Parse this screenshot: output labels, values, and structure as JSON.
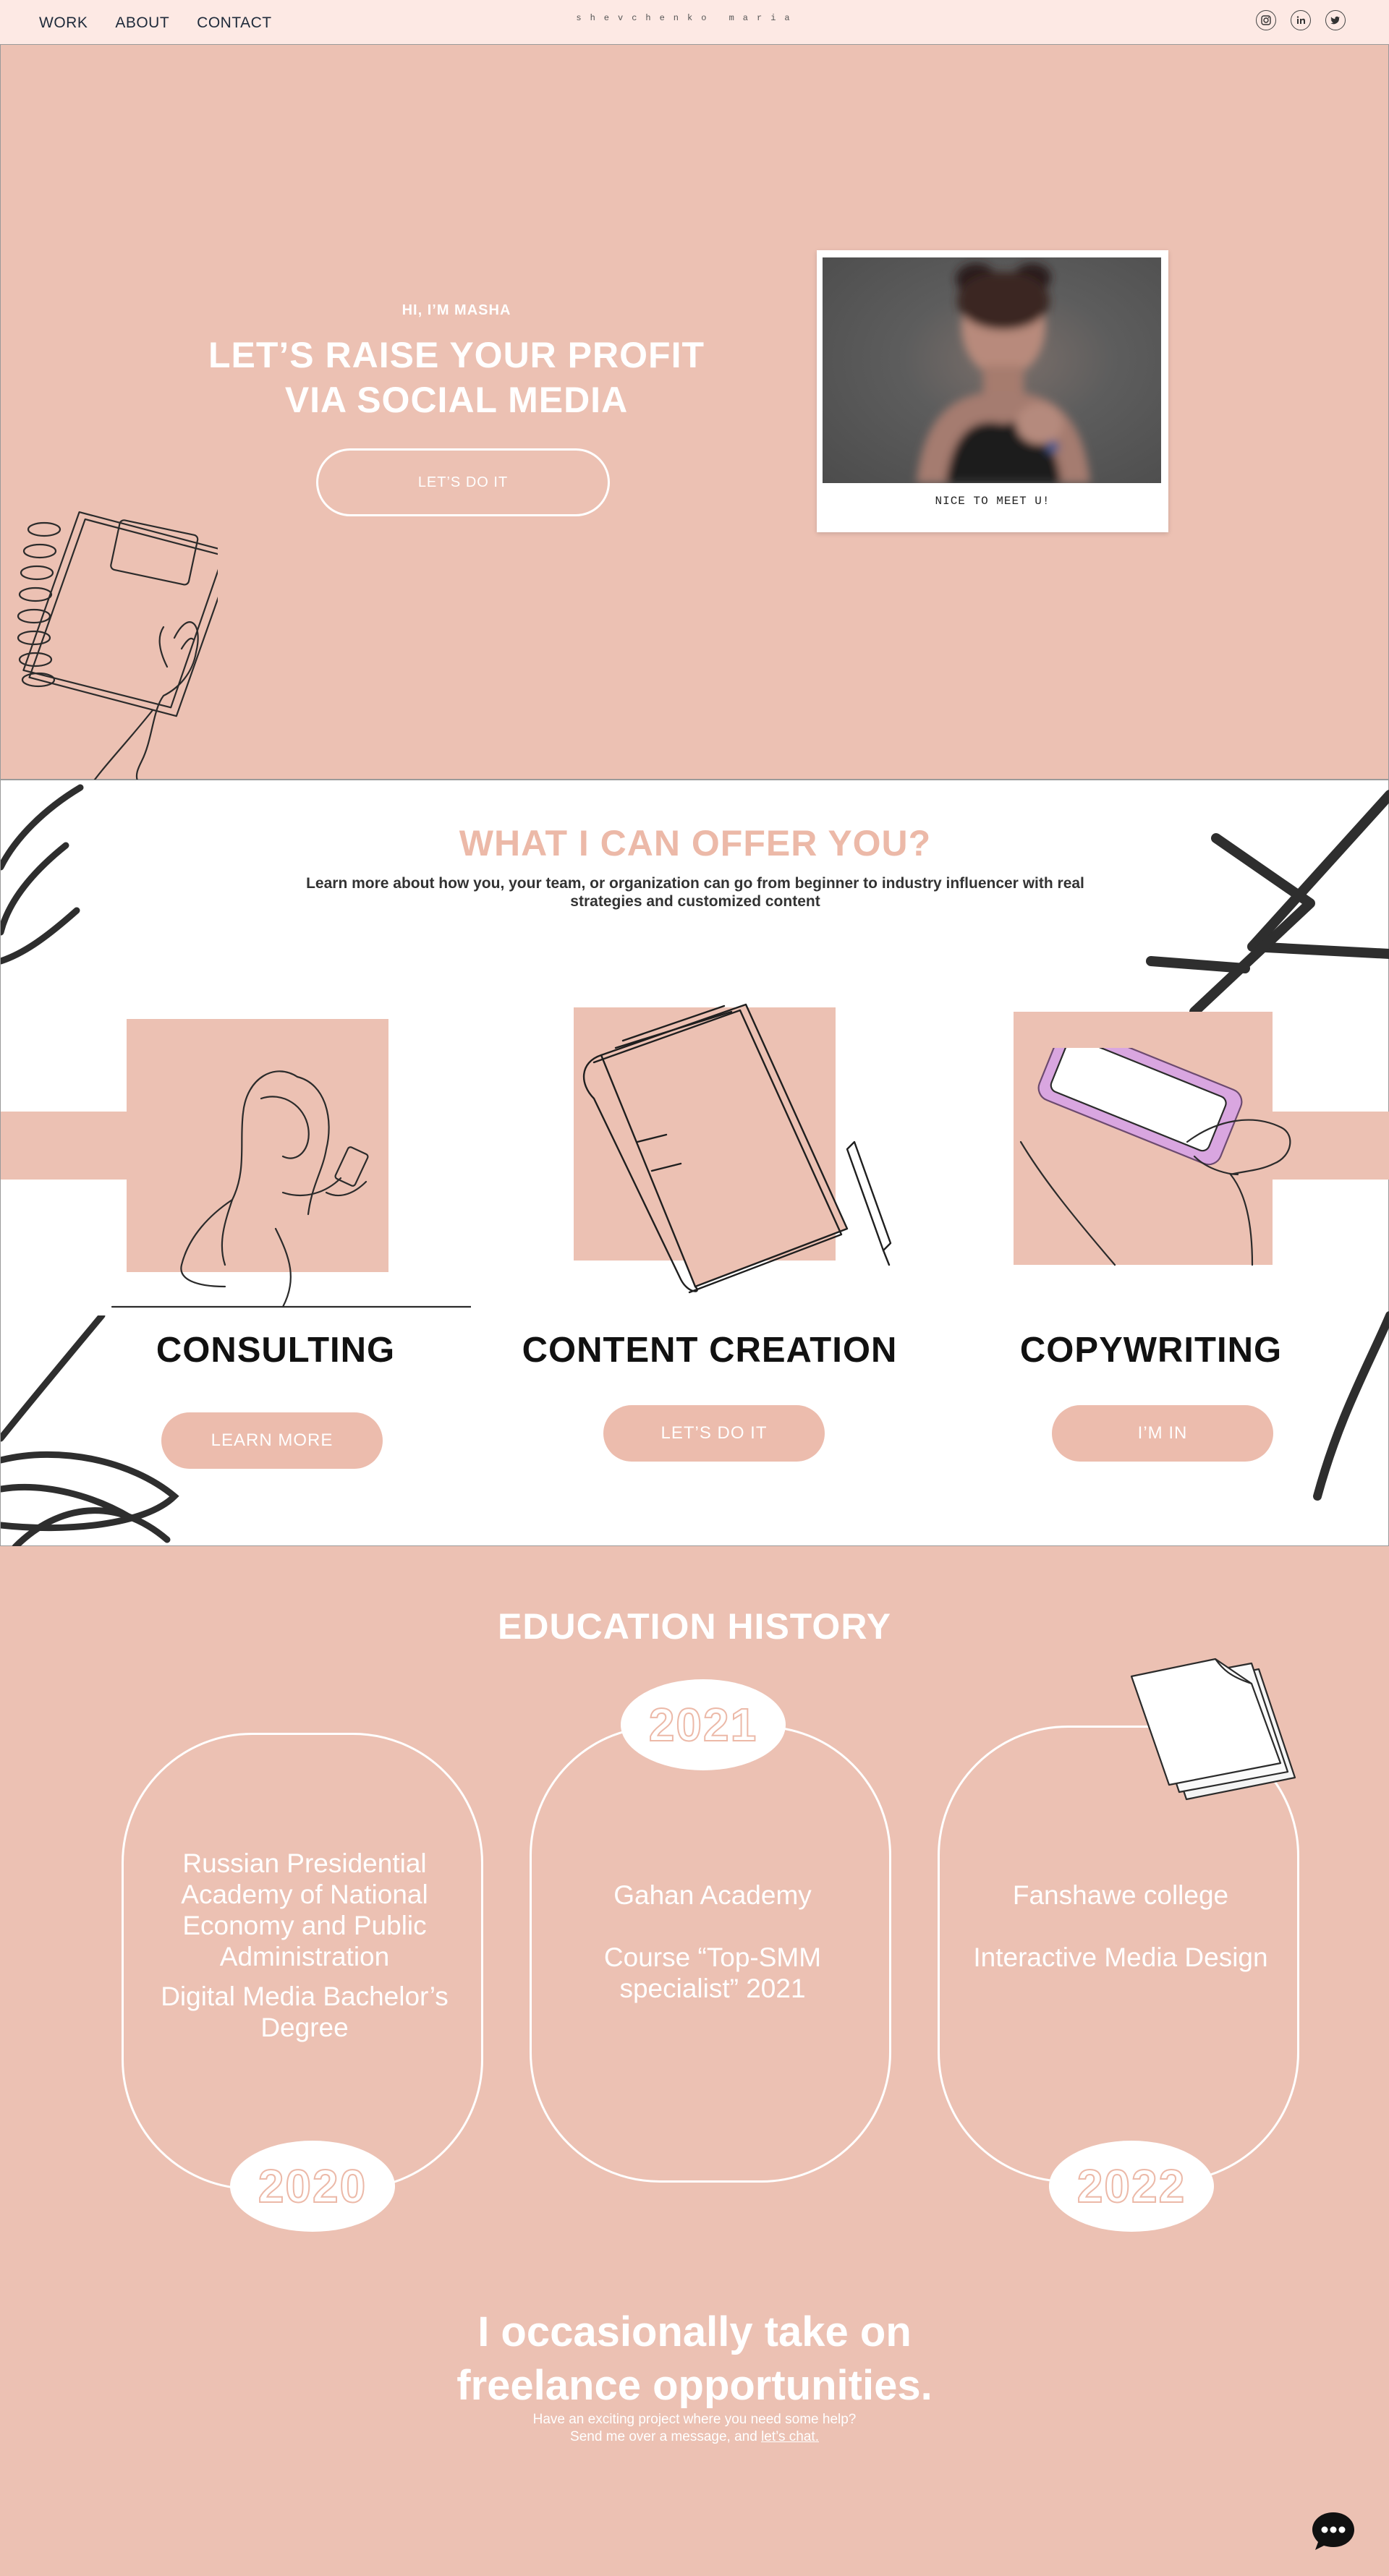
{
  "nav": {
    "links": [
      "WORK",
      "ABOUT",
      "CONTACT"
    ],
    "brand": "shevchenko maria",
    "socials": [
      "instagram-icon",
      "linkedin-icon",
      "twitter-icon"
    ]
  },
  "hero": {
    "kicker": "HI, I’M MASHA",
    "title_line1": "LET’S RAISE YOUR PROFIT",
    "title_line2": "VIA SOCIAL MEDIA",
    "cta": "LET’S DO IT",
    "polaroid_caption": "NICE TO MEET U!"
  },
  "offer": {
    "title": "WHAT I CAN OFFER YOU?",
    "subtitle_line1": "Learn more about how you, your team, or organization can go from beginner to industry influencer with real",
    "subtitle_line2": "strategies and customized content",
    "services": [
      {
        "title": "CONSULTING",
        "button": "LEARN MORE"
      },
      {
        "title": "CONTENT CREATION",
        "button": "LET’S DO IT"
      },
      {
        "title": "COPYWRITING",
        "button": "I’M IN"
      }
    ]
  },
  "education": {
    "title": "EDUCATION HISTORY",
    "cards": [
      {
        "year": "2020",
        "school": "Russian Presidential Academy of National Economy and Public Administration",
        "program": "Digital Media Bachelor’s Degree"
      },
      {
        "year": "2021",
        "school": "Gahan Academy",
        "program": "Course “Top-SMM specialist” 2021"
      },
      {
        "year": "2022",
        "school": "Fanshawe college",
        "program": "Interactive Media Design"
      }
    ]
  },
  "freelance": {
    "title_line1": "I occasionally take on",
    "title_line2": "freelance opportunities.",
    "sub_line1": "Have an exciting project where you need some help?",
    "sub_line2": "Send me over a message, and",
    "chat_link": "let’s chat."
  },
  "colors": {
    "accent_pink": "#ecc1b3",
    "nav_bg": "#fde9e4",
    "title_pink": "#ecb9a8",
    "text_dark": "#111111"
  },
  "widgets": {
    "chat_icon": "chat-bubble-icon"
  }
}
